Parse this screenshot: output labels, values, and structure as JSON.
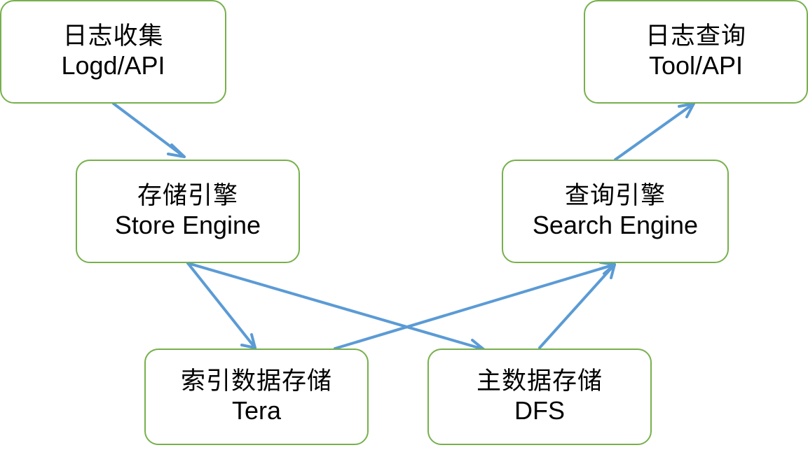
{
  "diagram": {
    "colors": {
      "node_border": "#77b04c",
      "arrow": "#5b9bd5",
      "text": "#000000",
      "background": "#ffffff"
    },
    "nodes": {
      "log_collect": {
        "zh": "日志收集",
        "en": "Logd/API"
      },
      "log_query": {
        "zh": "日志查询",
        "en": "Tool/API"
      },
      "store_engine": {
        "zh": "存储引擎",
        "en": "Store Engine"
      },
      "search_engine": {
        "zh": "查询引擎",
        "en": "Search Engine"
      },
      "index_storage": {
        "zh": "索引数据存储",
        "en": "Tera"
      },
      "main_storage": {
        "zh": "主数据存储",
        "en": "DFS"
      }
    }
  }
}
